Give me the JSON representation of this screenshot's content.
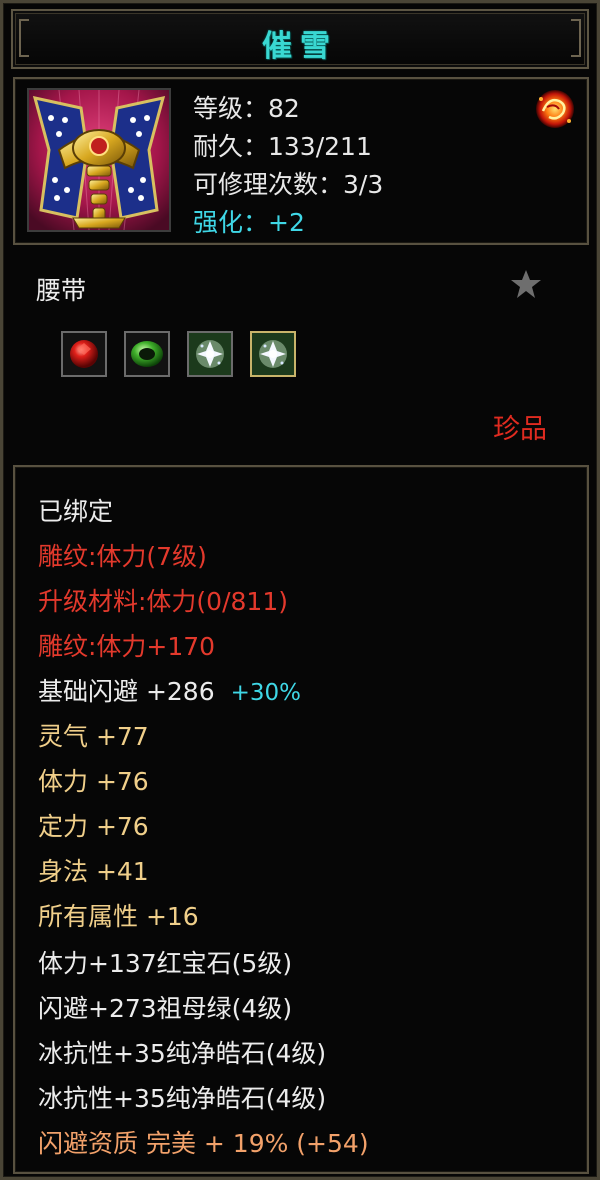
{
  "title": "催雪",
  "header": {
    "level": "等级：82",
    "durability": "耐久：133/211",
    "repair": "可修理次数：3/3",
    "enhance": "强化：+2"
  },
  "icons": {
    "item": "belt-item-icon",
    "orb": "fire-orb-icon",
    "star": "star-icon",
    "gems": [
      "ruby-gem-icon",
      "emerald-gem-icon",
      "pure-diamond-gem-icon",
      "pure-diamond-gem-icon"
    ]
  },
  "category": "腰带",
  "rarity": "珍品",
  "attributes": {
    "bound": "已绑定",
    "engrave": "雕纹:体力(7级)",
    "upgrade": "升级材料:体力(0/811)",
    "engrave_bonus": "雕纹:体力+170",
    "base_dodge": "基础闪避 +286",
    "base_dodge_pct": "+30%",
    "spirit": "灵气 +77",
    "stamina": "体力 +76",
    "focus": "定力 +76",
    "agility": "身法 +41",
    "all_attr": "所有属性 +16",
    "gem1": "体力+137红宝石(5级)",
    "gem2": "闪避+273祖母绿(4级)",
    "gem3": "冰抗性+35纯净皓石(4级)",
    "gem4": "冰抗性+35纯净皓石(4级)",
    "aptitude": "闪避资质 完美 + 19% (+54)"
  },
  "colors": {
    "title": "#39d8d2",
    "white": "#ececec",
    "red": "#e3392c",
    "gold": "#f0cf8a",
    "cyan": "#3fd7e6",
    "orange": "#f2a16a",
    "border": "#585140"
  }
}
